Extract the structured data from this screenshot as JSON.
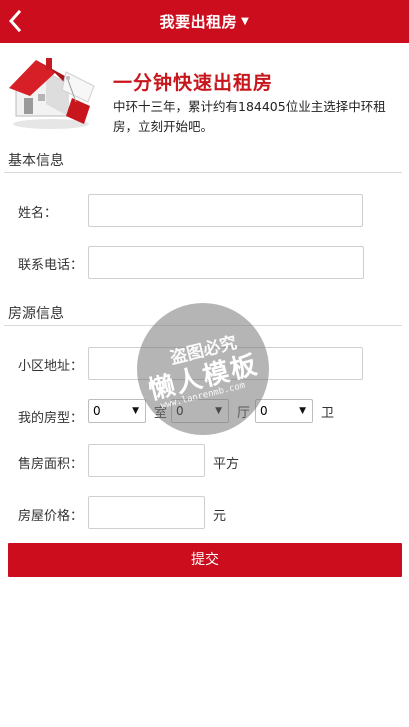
{
  "header": {
    "title": "我要出租房",
    "caret": "▼",
    "back_icon": "chevron-left-icon",
    "bg_color": "#cc0d1e"
  },
  "hero": {
    "title": "一分钟快速出租房",
    "description": "中环十三年，累计约有184405位业主选择中环租房，立刻开始吧。",
    "image_icon": "house-with-tag-icon"
  },
  "basic_section": {
    "title": "基本信息",
    "name_label": "姓名：",
    "name_value": "",
    "phone_label": "联系电话：",
    "phone_value": ""
  },
  "property_section": {
    "title": "房源信息",
    "address_label": "小区地址：",
    "address_value": "",
    "layout_label": "我的房型：",
    "rooms_value": "0",
    "rooms_unit": "室",
    "halls_value": "0",
    "halls_unit": "厅",
    "baths_value": "0",
    "baths_unit": "卫",
    "area_label": "售房面积：",
    "area_value": "",
    "area_unit": "平方",
    "price_label": "房屋价格：",
    "price_value": "",
    "price_unit": "元"
  },
  "submit_label": "提交",
  "watermark": {
    "top": "盗图必究",
    "main": "懒人模板",
    "url": "www.lanrenmb.com"
  }
}
